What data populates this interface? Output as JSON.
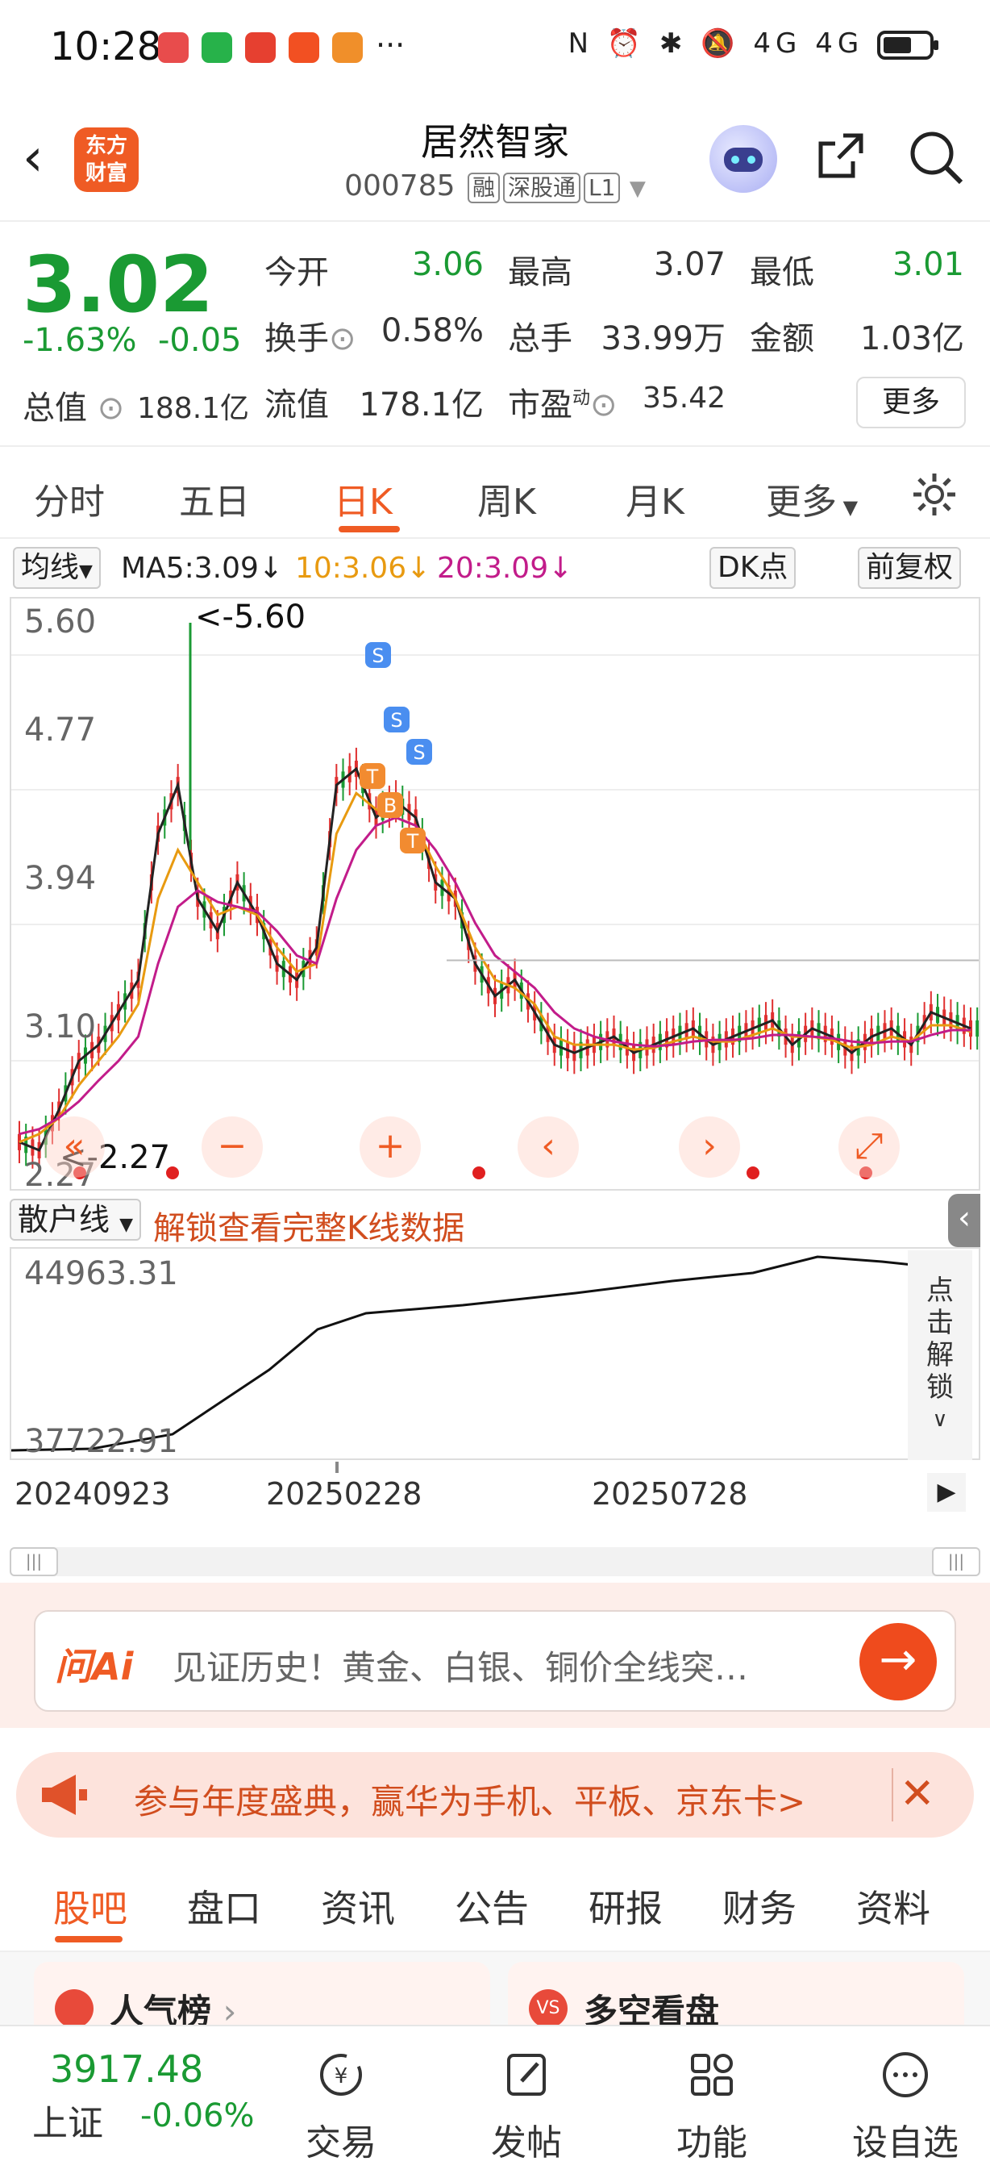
{
  "status_bar": {
    "time": "10:28",
    "more": "···",
    "icons": "N ⏰ ✱ 🔕 4G 4G"
  },
  "header": {
    "back": "‹",
    "logo_line1": "东方",
    "logo_line2": "财富",
    "stock_name": "居然智家",
    "stock_code": "000785",
    "tags": [
      "融",
      "深股通",
      "L1"
    ]
  },
  "quote": {
    "price": "3.02",
    "change_pct": "-1.63%",
    "change_abs": "-0.05",
    "open_label": "今开",
    "open": "3.06",
    "high_label": "最高",
    "high": "3.07",
    "low_label": "最低",
    "low": "3.01",
    "turnover_label": "换手",
    "turnover": "0.58%",
    "volume_label": "总手",
    "volume": "33.99万",
    "amount_label": "金额",
    "amount": "1.03亿",
    "mktcap_label": "总值",
    "mktcap": "188.1亿",
    "float_label": "流值",
    "float": "178.1亿",
    "pe_label": "市盈",
    "pe_sup": "动",
    "pe": "35.42",
    "more": "更多"
  },
  "kline_tabs": [
    "分时",
    "五日",
    "日K",
    "周K",
    "月K",
    "更多"
  ],
  "ma_row": {
    "type": "均线",
    "ma5": "MA5:3.09",
    "ma10": "10:3.06",
    "ma20": "20:3.09",
    "dk": "DK点",
    "adjust": "前复权"
  },
  "chart_data": {
    "type": "candlestick",
    "y_ticks": [
      "5.60",
      "4.77",
      "3.94",
      "3.10",
      "2.27"
    ],
    "ylim": [
      2.27,
      5.6
    ],
    "max_label": "<-5.60",
    "min_label": "<-2.27",
    "x_ticks": [
      "20240923",
      "20250228",
      "20250728"
    ],
    "ma5": [
      2.4,
      2.35,
      2.6,
      2.9,
      3.0,
      3.2,
      3.4,
      4.3,
      4.6,
      3.9,
      3.7,
      4.0,
      3.8,
      3.5,
      3.4,
      3.6,
      4.6,
      4.7,
      4.4,
      4.5,
      4.4,
      4.0,
      3.9,
      3.5,
      3.3,
      3.4,
      3.2,
      3.0,
      2.95,
      3.0,
      3.05,
      2.95,
      3.0,
      3.05,
      3.1,
      3.0,
      3.05,
      3.1,
      3.15,
      3.0,
      3.1,
      3.05,
      2.95,
      3.05,
      3.1,
      3.0,
      3.2,
      3.15,
      3.1
    ],
    "ma10": [
      2.4,
      2.45,
      2.55,
      2.75,
      2.9,
      3.05,
      3.25,
      3.9,
      4.2,
      4.0,
      3.8,
      3.85,
      3.8,
      3.6,
      3.45,
      3.5,
      4.3,
      4.55,
      4.45,
      4.4,
      4.35,
      4.1,
      3.9,
      3.6,
      3.4,
      3.35,
      3.25,
      3.05,
      3.0,
      3.0,
      3.0,
      2.97,
      2.98,
      3.02,
      3.05,
      3.02,
      3.02,
      3.06,
      3.1,
      3.05,
      3.05,
      3.03,
      2.98,
      3.0,
      3.05,
      3.02,
      3.12,
      3.12,
      3.08
    ],
    "ma20": [
      2.45,
      2.48,
      2.55,
      2.65,
      2.78,
      2.9,
      3.05,
      3.5,
      3.85,
      3.95,
      3.88,
      3.85,
      3.82,
      3.7,
      3.55,
      3.5,
      3.9,
      4.2,
      4.35,
      4.4,
      4.35,
      4.2,
      4.0,
      3.75,
      3.55,
      3.45,
      3.35,
      3.2,
      3.1,
      3.05,
      3.02,
      3.0,
      2.99,
      3.0,
      3.02,
      3.03,
      3.03,
      3.04,
      3.06,
      3.06,
      3.05,
      3.04,
      3.02,
      3.01,
      3.02,
      3.02,
      3.06,
      3.09,
      3.09
    ]
  },
  "sub_indicator": {
    "name": "散户线",
    "unlock": "解锁查看完整K线数据",
    "y_top": "44963.31",
    "y_bottom": "37722.91",
    "side": [
      "点",
      "击",
      "解",
      "锁"
    ]
  },
  "ai": {
    "logo": "问Ai",
    "text": "见证历史！黄金、白银、铜价全线突…"
  },
  "promo": {
    "text": "参与年度盛典，赢华为手机、平板、京东卡>"
  },
  "bottom_tabs": [
    "股吧",
    "盘口",
    "资讯",
    "公告",
    "研报",
    "财务",
    "资料"
  ],
  "cards": [
    "人气榜",
    "多空看盘"
  ],
  "index": {
    "value": "3917.48",
    "name": "上证",
    "change": "-0.06%"
  },
  "nav": [
    "交易",
    "发帖",
    "功能",
    "设自选"
  ],
  "colors": {
    "accent": "#ef5b24",
    "down": "#1a9a33",
    "ma5": "#222222",
    "ma10": "#e89a10",
    "ma20": "#c21c8a"
  }
}
